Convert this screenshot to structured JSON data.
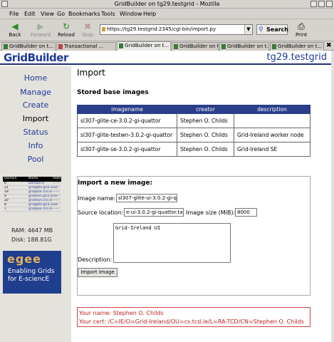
{
  "window": {
    "title": "GridBuilder on tg29.testgrid - Mozilla"
  },
  "menu": [
    "File",
    "Edit",
    "View",
    "Go",
    "Bookmarks",
    "Tools",
    "Window",
    "Help"
  ],
  "toolbar": {
    "back": "Back",
    "forward": "Forward",
    "reload": "Reload",
    "stop": "Stop",
    "url": "https://tg29.testgrid:2345/cgi-bin/import.py",
    "search": "Search",
    "print": "Print"
  },
  "tabs": [
    "GridBuilder on t...",
    "Transactional ...",
    "GridBuilder on t...",
    "GridBuilder on t...",
    "GridBuilder on t...",
    "GridBuilder on t..."
  ],
  "header": {
    "logo": "GridBuilder",
    "hostname": "tg29.testgrid"
  },
  "sidebar": {
    "items": [
      "Home",
      "Manage",
      "Create",
      "Import",
      "Status",
      "Info",
      "Pool"
    ],
    "mini_table": {
      "headers": [
        "Domain",
        "Name",
        "State"
      ],
      "rows": [
        [
          "0",
          "Domain-0",
          "------"
        ],
        [
          "21",
          "gridgate.grid.ul.ie",
          "------"
        ],
        [
          "19",
          "gridpool.rcsi.ie",
          "------"
        ],
        [
          "9",
          "gridmon.grid.ul.ie",
          "------"
        ],
        [
          "20",
          "gridmon.rcsi.ie",
          "------"
        ],
        [
          "8",
          "gridgate.grid.ul.ie",
          "------"
        ],
        [
          "7",
          "gridpool.rcsi.ie",
          "------"
        ]
      ]
    },
    "ram": "RAM: 4647 MB",
    "disk": "Disk: 188.81G",
    "egee_logo": "egee",
    "egee_tagline_1": "Enabling Grids",
    "egee_tagline_2": "for E-sciencE"
  },
  "main": {
    "title": "Import",
    "stored_heading": "Stored base images",
    "table": {
      "headers": [
        "imagename",
        "creator",
        "description"
      ],
      "rows": [
        [
          "sl307-glite-ce-3.0.2-gi-quattor",
          "Stephen O. Childs",
          ""
        ],
        [
          "sl307-glite-testwn-3.0.2-gi-quattor",
          "Stephen O. Childs",
          "Grid-Ireland worker node"
        ],
        [
          "sl307-glite-se-3.0.2-gi-quattor",
          "Stephen O. Childs",
          "Grid-Ireland SE"
        ]
      ]
    },
    "form": {
      "heading": "Import a new image:",
      "image_name_label": "Image name:",
      "image_name_value": "sl307-glite-ui-3.0.2-gi-qua",
      "source_label": "Source location:",
      "source_value": "e-ui-3.0.2-gi-quattor.tar.gz",
      "size_label": "Image size (MiB):",
      "size_value": "8000",
      "description_label": "Description:",
      "description_value": "Grid-Ireland UI",
      "button": "Import image"
    },
    "user": {
      "name": "Your name: Stephen O. Childs",
      "cert": "Your cert: /C=IE/O=Grid-Ireland/OU=cs.tcd.ie/L=RA-TCD/CN=Stephen O. Childs"
    }
  },
  "colors": {
    "header_blue": "#1f3a9a",
    "table_header": "#2a3e8a",
    "user_red": "#b22222",
    "egee_blue": "#1f3e8e"
  }
}
